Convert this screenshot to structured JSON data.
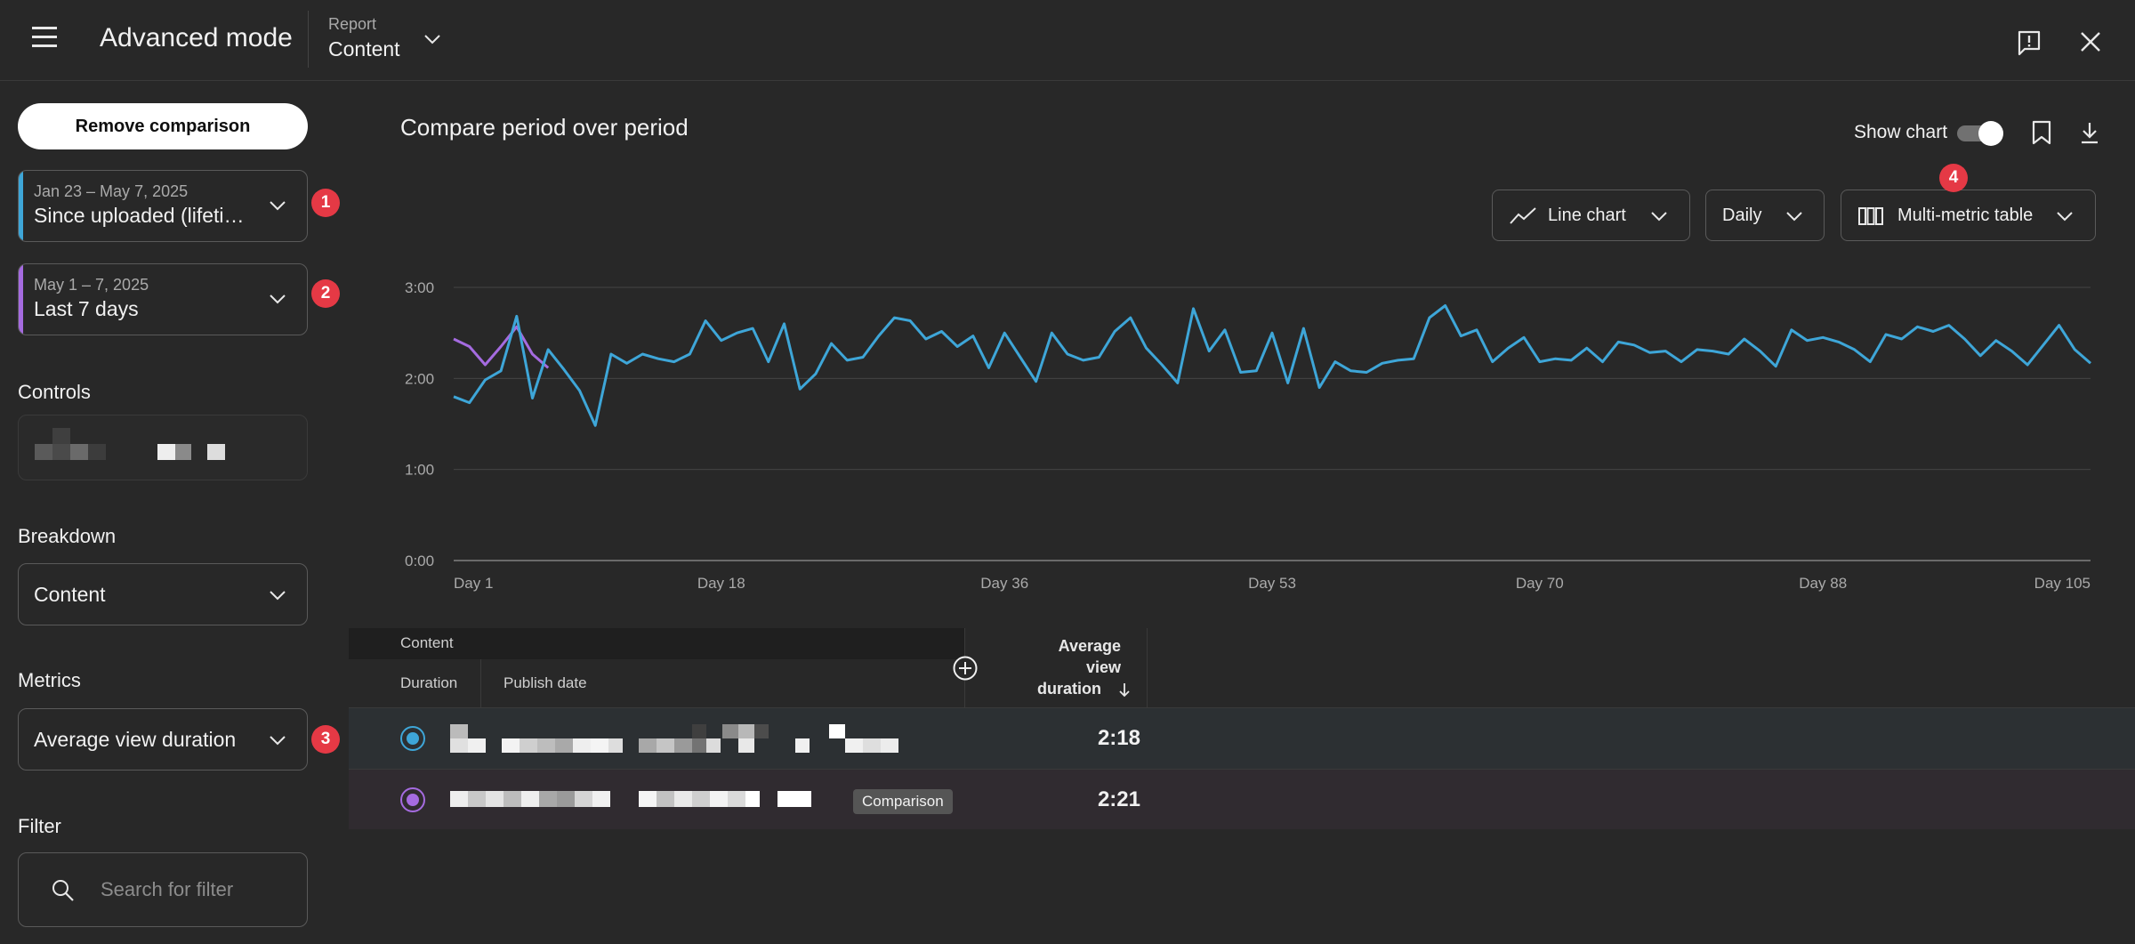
{
  "header": {
    "title": "Advanced mode",
    "report_label": "Report",
    "report_value": "Content"
  },
  "sidebar": {
    "remove_comparison_label": "Remove comparison",
    "period_primary": {
      "range": "Jan 23 – May 7, 2025",
      "label": "Since uploaded (lifeti…",
      "badge": "1",
      "color": "#3ea6d8"
    },
    "period_comparison": {
      "range": "May 1 – 7, 2025",
      "label": "Last 7 days",
      "badge": "2",
      "color": "#a56be0"
    },
    "controls_label": "Controls",
    "breakdown_label": "Breakdown",
    "breakdown_value": "Content",
    "metrics_label": "Metrics",
    "metrics_value": "Average view duration",
    "metrics_badge": "3",
    "filter_label": "Filter",
    "filter_placeholder": "Search for filter"
  },
  "main": {
    "title": "Compare period over period",
    "show_chart_label": "Show chart",
    "show_chart_on": true,
    "chart_type_label": "Line chart",
    "interval_label": "Daily",
    "table_type_label": "Multi-metric table",
    "table_type_badge": "4"
  },
  "chart_data": {
    "type": "line",
    "ylabel": "",
    "xlabel": "",
    "y_ticks": [
      "0:00",
      "1:00",
      "2:00",
      "3:00"
    ],
    "x_ticks": [
      "Day 1",
      "Day 18",
      "Day 36",
      "Day 53",
      "Day 70",
      "Day 88",
      "Day 105"
    ],
    "ylim": [
      0,
      180
    ],
    "xlim": [
      1,
      105
    ],
    "series": [
      {
        "color": "#3ea6d8",
        "x": [
          1,
          2,
          3,
          4,
          5,
          6,
          7,
          8,
          9,
          10,
          11,
          12,
          13,
          14,
          15,
          16,
          17,
          18,
          19,
          20,
          21,
          22,
          23,
          24,
          25,
          26,
          27,
          28,
          29,
          30,
          31,
          32,
          33,
          34,
          35,
          36,
          37,
          38,
          39,
          40,
          41,
          42,
          43,
          44,
          45,
          46,
          47,
          48,
          49,
          50,
          51,
          52,
          53,
          54,
          55,
          56,
          57,
          58,
          59,
          60,
          61,
          62,
          63,
          64,
          65,
          66,
          67,
          68,
          69,
          70,
          71,
          72,
          73,
          74,
          75,
          76,
          77,
          78,
          79,
          80,
          81,
          82,
          83,
          84,
          85,
          86,
          87,
          88,
          89,
          90,
          91,
          92,
          93,
          94,
          95,
          96,
          97,
          98,
          99,
          100,
          101,
          102,
          103,
          104,
          105
        ],
        "values": [
          108,
          104,
          119,
          125,
          161,
          107,
          139,
          126,
          112,
          89,
          136,
          130,
          136,
          133,
          131,
          136,
          158,
          145,
          150,
          153,
          131,
          156,
          113,
          123,
          143,
          132,
          134,
          148,
          160,
          158,
          146,
          151,
          141,
          148,
          127,
          150,
          134,
          118,
          150,
          136,
          132,
          134,
          151,
          160,
          140,
          129,
          117,
          166,
          138,
          152,
          124,
          125,
          150,
          117,
          153,
          114,
          131,
          125,
          124,
          130,
          132,
          133,
          160,
          168,
          148,
          152,
          131,
          140,
          147,
          131,
          133,
          132,
          140,
          131,
          144,
          142,
          137,
          138,
          131,
          139,
          138,
          136,
          146,
          138,
          128,
          152,
          145,
          147,
          144,
          139,
          131,
          149,
          146,
          154,
          151,
          155,
          146,
          135,
          145,
          138,
          129,
          142,
          155,
          139,
          130
        ]
      },
      {
        "color": "#a56be0",
        "x": [
          1,
          2,
          3,
          4,
          5,
          6,
          7
        ],
        "values": [
          146,
          141,
          129,
          141,
          154,
          136,
          127
        ]
      }
    ]
  },
  "table": {
    "group_label": "Content",
    "col_duration": "Duration",
    "col_publish_date": "Publish date",
    "metric_header_lines": [
      "Average",
      "view",
      "duration"
    ],
    "rows": [
      {
        "value": "2:18",
        "radio_color": "#3ea6d8"
      },
      {
        "value": "2:21",
        "radio_color": "#a56be0",
        "badge": "Comparison"
      }
    ]
  }
}
